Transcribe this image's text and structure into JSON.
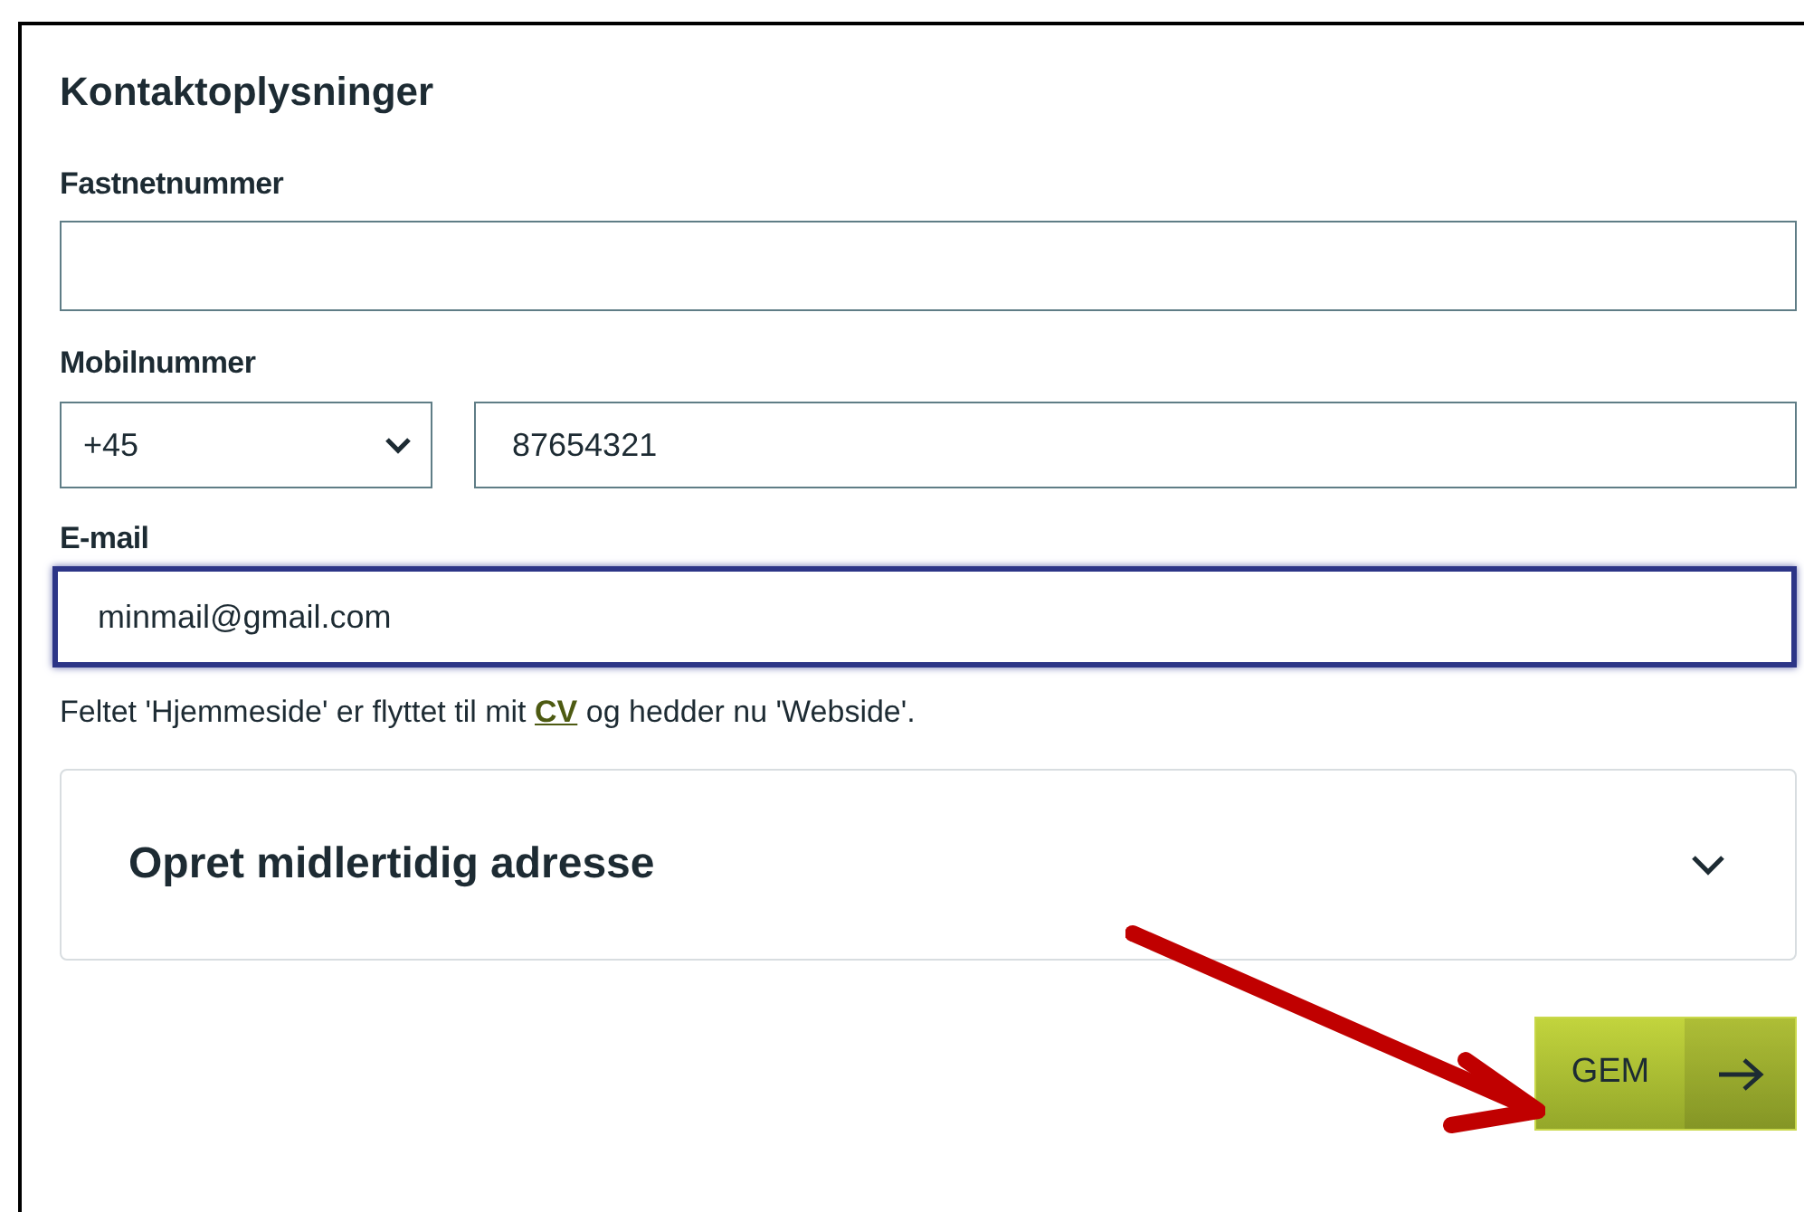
{
  "section": {
    "title": "Kontaktoplysninger"
  },
  "landline": {
    "label": "Fastnetnummer"
  },
  "mobile": {
    "label": "Mobilnummer",
    "country_code": "+45",
    "value": "87654321"
  },
  "email": {
    "label": "E-mail",
    "value": "minmail@gmail.com",
    "focused": true
  },
  "note": {
    "before": "Feltet 'Hjemmeside' er flyttet til mit",
    "link": "CV",
    "after": "og hedder nu 'Webside'."
  },
  "accordion": {
    "title": "Opret midlertidig adresse",
    "expanded": false
  },
  "save_button": {
    "label": "GEM"
  },
  "annotation": {
    "kind": "arrow"
  }
}
